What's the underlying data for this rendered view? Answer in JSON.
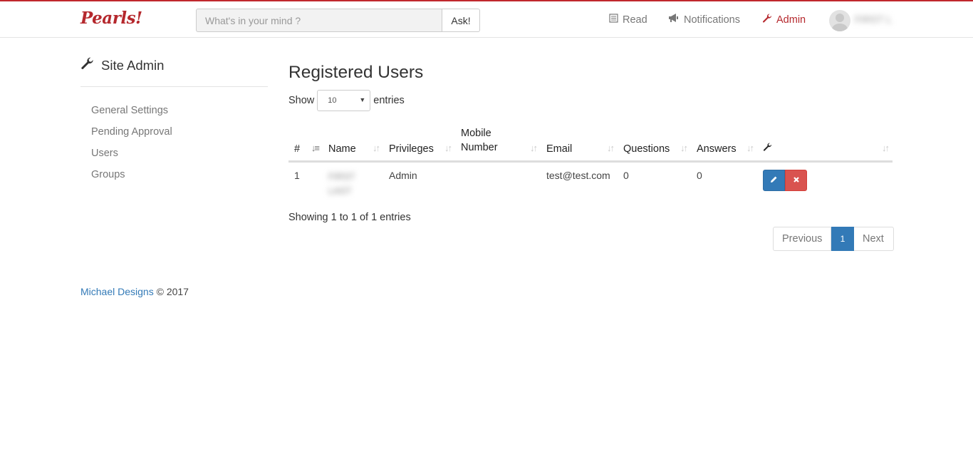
{
  "brand": "Pearls!",
  "search": {
    "placeholder": "What's in your mind ?",
    "button": "Ask!"
  },
  "nav": {
    "read": "Read",
    "notifications": "Notifications",
    "admin": "Admin",
    "user_name": "FIRST L"
  },
  "sidebar": {
    "title": "Site Admin",
    "items": [
      {
        "label": "General Settings"
      },
      {
        "label": "Pending Approval"
      },
      {
        "label": "Users"
      },
      {
        "label": "Groups"
      }
    ]
  },
  "main": {
    "title": "Registered Users",
    "show_label": "Show",
    "entries_value": "10",
    "entries_label": "entries",
    "columns": [
      "#",
      "Name",
      "Privileges",
      "Mobile Number",
      "Email",
      "Questions",
      "Answers"
    ],
    "rows": [
      {
        "id": "1",
        "name_first": "FIRST",
        "name_last": "LAST",
        "privileges": "Admin",
        "mobile": "",
        "email": "test@test.com",
        "questions": "0",
        "answers": "0"
      }
    ],
    "info": "Showing 1 to 1 of 1 entries",
    "pagination": {
      "previous": "Previous",
      "current": "1",
      "next": "Next"
    }
  },
  "footer": {
    "company": "Michael Designs",
    "copyright": "© 2017"
  },
  "colors": {
    "brand": "#b5282d",
    "primary": "#337ab7",
    "danger": "#d9534f"
  },
  "icons": [
    "book-icon",
    "bullhorn-icon",
    "wrench-icon",
    "pencil-icon",
    "remove-icon",
    "sort-icon"
  ]
}
